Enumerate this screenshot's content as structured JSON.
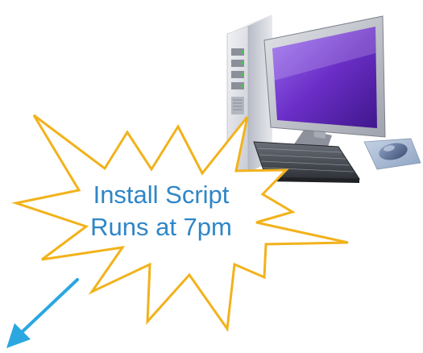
{
  "callout": {
    "line1": "Install Script",
    "line2": "Runs at 7pm"
  },
  "icons": [
    "computer-icon",
    "tower-icon",
    "monitor-icon",
    "keyboard-icon",
    "mouse-icon",
    "arrow-icon"
  ],
  "colors": {
    "starburst_stroke": "#f2b21b",
    "starburst_fill": "#ffffff",
    "text": "#2f86c7",
    "arrow": "#2aa7e0",
    "screen": "#6b2fc7",
    "case": "#d9dadf"
  }
}
